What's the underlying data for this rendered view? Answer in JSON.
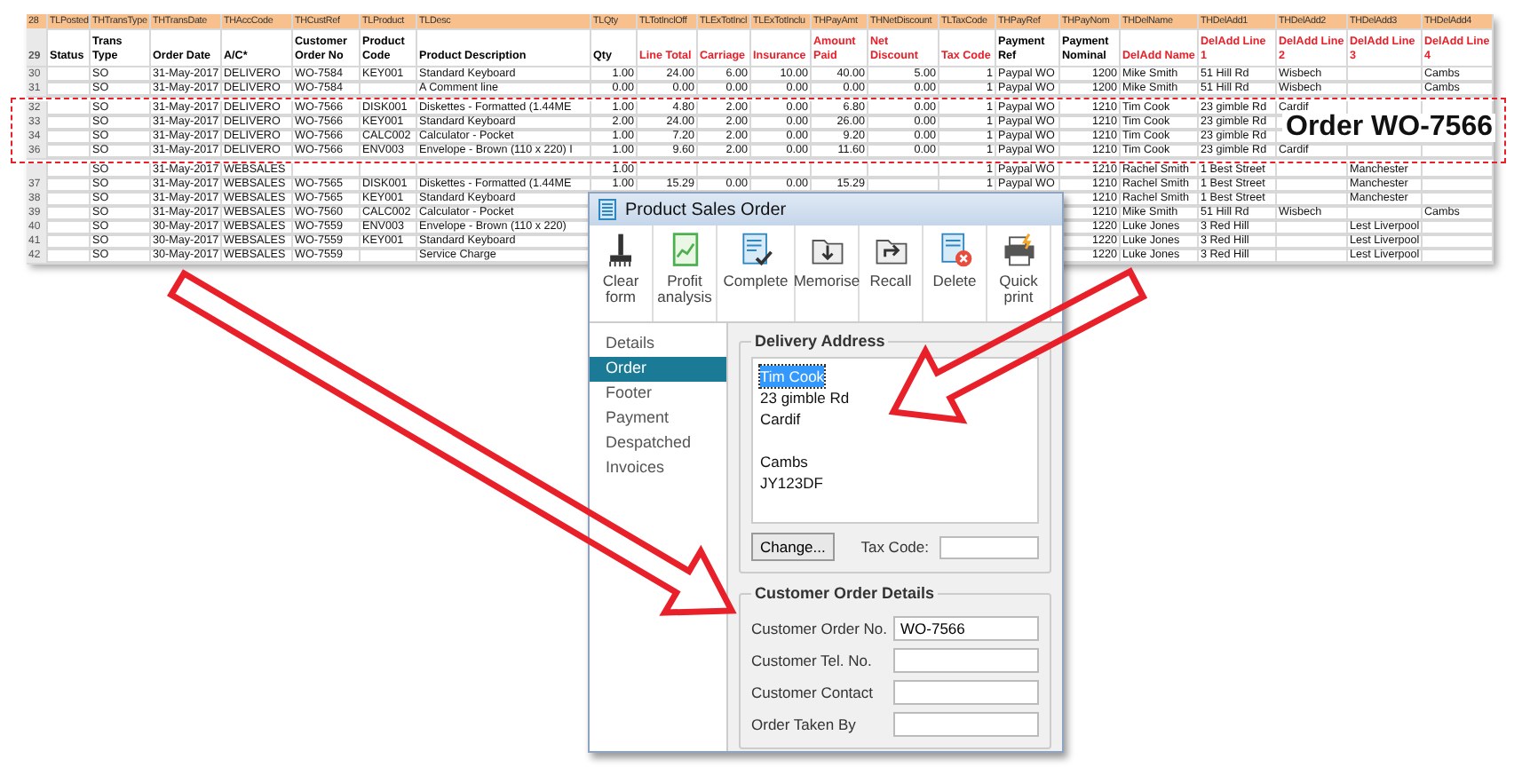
{
  "sheet": {
    "field_row": {
      "number": "28",
      "fields": [
        "TLPosted",
        "THTransType",
        "THTransDate",
        "THAccCode",
        "THCustRef",
        "TLProduct",
        "TLDesc",
        "TLQty",
        "TLTotInclOff",
        "TLExTotIncl",
        "TLExTotInclu",
        "THPayAmt",
        "THNetDiscount",
        "TLTaxCode",
        "THPayRef",
        "THPayNom",
        "THDelName",
        "THDelAdd1",
        "THDelAdd2",
        "THDelAdd3",
        "THDelAdd4"
      ]
    },
    "header_row": {
      "number": "29",
      "headers": [
        {
          "text": "Status",
          "color": "#000000"
        },
        {
          "text": "Trans Type",
          "color": "#000000"
        },
        {
          "text": "Order Date",
          "color": "#000000"
        },
        {
          "text": "A/C*",
          "color": "#000000"
        },
        {
          "text": "Customer Order No",
          "color": "#000000"
        },
        {
          "text": "Product Code",
          "color": "#000000"
        },
        {
          "text": "Product Description",
          "color": "#000000"
        },
        {
          "text": "Qty",
          "color": "#000000"
        },
        {
          "text": "Line Total",
          "color": "#e8202a"
        },
        {
          "text": "Carriage",
          "color": "#e8202a"
        },
        {
          "text": "Insurance",
          "color": "#e8202a"
        },
        {
          "text": "Amount Paid",
          "color": "#e8202a"
        },
        {
          "text": "Net Discount",
          "color": "#e8202a"
        },
        {
          "text": "Tax Code",
          "color": "#e8202a"
        },
        {
          "text": "Payment Ref",
          "color": "#000000"
        },
        {
          "text": "Payment Nominal",
          "color": "#000000"
        },
        {
          "text": "DelAdd Name",
          "color": "#e8202a"
        },
        {
          "text": "DelAdd Line 1",
          "color": "#e8202a"
        },
        {
          "text": "DelAdd Line 2",
          "color": "#e8202a"
        },
        {
          "text": "DelAdd Line 3",
          "color": "#e8202a"
        },
        {
          "text": "DelAdd Line 4",
          "color": "#e8202a"
        }
      ]
    },
    "rows": [
      {
        "number": "30",
        "cells": [
          null,
          "SO",
          "31-May-2017",
          "DELIVERO",
          "WO-7584",
          "KEY001",
          "Standard Keyboard",
          "1.00",
          "24.00",
          "6.00",
          "10.00",
          "40.00",
          "5.00",
          "1",
          "Paypal WO",
          "1200",
          "Mike Smith",
          "51 Hill Rd",
          "Wisbech",
          null,
          "Cambs"
        ]
      },
      {
        "number": "31",
        "cells": [
          null,
          "SO",
          "31-May-2017",
          "DELIVERO",
          "WO-7584",
          null,
          "A Comment line",
          "0.00",
          "0.00",
          "0.00",
          "0.00",
          "0.00",
          "0.00",
          "1",
          "Paypal WO",
          "1200",
          "Mike Smith",
          "51 Hill Rd",
          "Wisbech",
          null,
          "Cambs"
        ]
      },
      {
        "number": "32",
        "cells": [
          null,
          "SO",
          "31-May-2017",
          "DELIVERO",
          "WO-7566",
          "DISK001",
          "Diskettes - Formatted (1.44ME",
          "1.00",
          "4.80",
          "2.00",
          "0.00",
          "6.80",
          "0.00",
          "1",
          "Paypal WO",
          "1210",
          "Tim Cook",
          "23 gimble Rd",
          "Cardif",
          null,
          null
        ]
      },
      {
        "number": "33",
        "cells": [
          null,
          "SO",
          "31-May-2017",
          "DELIVERO",
          "WO-7566",
          "KEY001",
          "Standard Keyboard",
          "2.00",
          "24.00",
          "2.00",
          "0.00",
          "26.00",
          "0.00",
          "1",
          "Paypal WO",
          "1210",
          "Tim Cook",
          "23 gimble Rd",
          null,
          null,
          null
        ]
      },
      {
        "number": "34",
        "cells": [
          null,
          "SO",
          "31-May-2017",
          "DELIVERO",
          "WO-7566",
          "CALC002",
          "Calculator - Pocket",
          "1.00",
          "7.20",
          "2.00",
          "0.00",
          "9.20",
          "0.00",
          "1",
          "Paypal WO",
          "1210",
          "Tim Cook",
          "23 gimble Rd",
          null,
          null,
          null
        ]
      },
      {
        "number": "36",
        "cells": [
          null,
          "SO",
          "31-May-2017",
          "DELIVERO",
          "WO-7566",
          "ENV003",
          "Envelope - Brown (110 x 220) I",
          "1.00",
          "9.60",
          "2.00",
          "0.00",
          "11.60",
          "0.00",
          "1",
          "Paypal WO",
          "1210",
          "Tim Cook",
          "23 gimble Rd",
          "Cardif",
          null,
          null
        ]
      },
      {
        "number": null,
        "cells": [
          null,
          "SO",
          "31-May-2017",
          "WEBSALES",
          null,
          null,
          null,
          "1.00",
          null,
          null,
          null,
          null,
          null,
          "1",
          "Paypal WO",
          "1210",
          "Rachel Smith",
          "1 Best Street",
          null,
          "Manchester",
          null
        ]
      },
      {
        "number": "37",
        "cells": [
          null,
          "SO",
          "31-May-2017",
          "WEBSALES",
          "WO-7565",
          "DISK001",
          "Diskettes - Formatted (1.44ME",
          "1.00",
          "15.29",
          "0.00",
          "0.00",
          "15.29",
          null,
          "1",
          "Paypal WO",
          "1210",
          "Rachel Smith",
          "1 Best Street",
          null,
          "Manchester",
          null
        ]
      },
      {
        "number": "38",
        "cells": [
          null,
          "SO",
          "31-May-2017",
          "WEBSALES",
          "WO-7565",
          "KEY001",
          "Standard Keyboard",
          null,
          null,
          null,
          null,
          null,
          null,
          null,
          null,
          "1210",
          "Rachel Smith",
          "1 Best Street",
          null,
          "Manchester",
          null
        ]
      },
      {
        "number": "39",
        "cells": [
          null,
          "SO",
          "31-May-2017",
          "WEBSALES",
          "WO-7560",
          "CALC002",
          "Calculator - Pocket",
          null,
          null,
          null,
          null,
          null,
          null,
          null,
          null,
          "1210",
          "Mike Smith",
          "51 Hill Rd",
          "Wisbech",
          null,
          "Cambs"
        ]
      },
      {
        "number": "40",
        "cells": [
          null,
          "SO",
          "30-May-2017",
          "WEBSALES",
          "WO-7559",
          "ENV003",
          "Envelope - Brown (110 x 220)",
          null,
          null,
          null,
          null,
          null,
          null,
          null,
          null,
          "1220",
          "Luke Jones",
          "3 Red Hill",
          null,
          "Lest Liverpool",
          null
        ]
      },
      {
        "number": "41",
        "cells": [
          null,
          "SO",
          "30-May-2017",
          "WEBSALES",
          "WO-7559",
          "KEY001",
          "Standard Keyboard",
          null,
          null,
          null,
          null,
          null,
          null,
          null,
          null,
          "1220",
          "Luke Jones",
          "3 Red Hill",
          null,
          "Lest Liverpool",
          null
        ]
      },
      {
        "number": "42",
        "cells": [
          null,
          "SO",
          "30-May-2017",
          "WEBSALES",
          "WO-7559",
          null,
          "Service Charge",
          null,
          null,
          null,
          null,
          null,
          null,
          null,
          null,
          "1220",
          "Luke Jones",
          "3 Red Hill",
          null,
          "Lest Liverpool",
          null
        ]
      }
    ]
  },
  "callout": {
    "text": "Order WO-7566"
  },
  "dialog": {
    "title": "Product Sales Order",
    "toolbar": [
      {
        "label": "Clear form"
      },
      {
        "label": "Profit analysis"
      },
      {
        "label": "Complete"
      },
      {
        "label": "Memorise"
      },
      {
        "label": "Recall"
      },
      {
        "label": "Delete"
      },
      {
        "label": "Quick print"
      }
    ],
    "nav": [
      {
        "label": "Details",
        "selected": false
      },
      {
        "label": "Order",
        "selected": true
      },
      {
        "label": "Footer",
        "selected": false
      },
      {
        "label": "Payment",
        "selected": false
      },
      {
        "label": "Despatched",
        "selected": false
      },
      {
        "label": "Invoices",
        "selected": false
      }
    ],
    "delivery_address": {
      "legend": "Delivery Address",
      "lines": [
        {
          "kind": "text",
          "text": "Tim Cook",
          "selected": true
        },
        {
          "kind": "text",
          "text": "23 gimble Rd",
          "selected": false
        },
        {
          "kind": "text",
          "text": "Cardif",
          "selected": false
        },
        {
          "kind": "blank"
        },
        {
          "kind": "text",
          "text": "Cambs",
          "selected": false
        },
        {
          "kind": "text",
          "text": "JY123DF",
          "selected": false
        }
      ],
      "change_button": "Change...",
      "tax_code_label": "Tax Code:"
    },
    "customer_order": {
      "legend": "Customer Order Details",
      "fields": [
        {
          "label": "Customer Order No.",
          "value": "WO-7566"
        },
        {
          "label": "Customer Tel. No."
        },
        {
          "label": "Customer Contact"
        },
        {
          "label": "Order Taken By"
        }
      ]
    }
  }
}
